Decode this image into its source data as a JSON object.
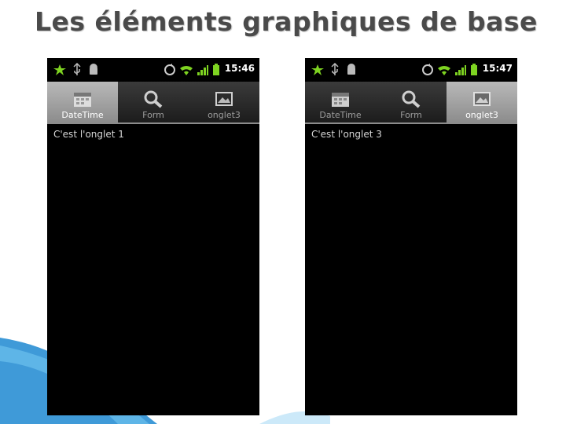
{
  "slide": {
    "title": "Les éléments graphiques de base"
  },
  "phones": [
    {
      "status_time": "15:46",
      "tabs": [
        {
          "label": "DateTime",
          "icon": "calendar-icon"
        },
        {
          "label": "Form",
          "icon": "search-wrench-icon"
        },
        {
          "label": "onglet3",
          "icon": "picture-icon"
        }
      ],
      "selected_tab": "DateTime",
      "content_text": "C'est l'onglet 1"
    },
    {
      "status_time": "15:47",
      "tabs": [
        {
          "label": "DateTime",
          "icon": "calendar-icon"
        },
        {
          "label": "Form",
          "icon": "search-wrench-icon"
        },
        {
          "label": "onglet3",
          "icon": "picture-icon"
        }
      ],
      "selected_tab": "onglet3",
      "content_text": "C'est l'onglet 3"
    }
  ],
  "colors": {
    "title": "#4a4a4a",
    "status_green": "#7ed321",
    "selected_tab_bg": "#9e9e9e",
    "deco_blue": "#2a8fd4"
  }
}
